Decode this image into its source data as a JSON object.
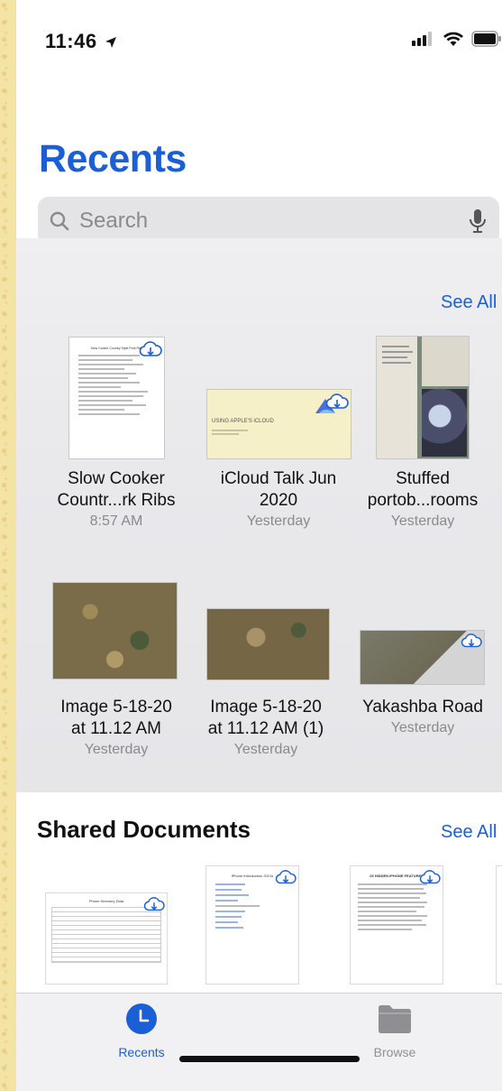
{
  "status_bar": {
    "time": "11:46",
    "location_icon": "location-arrow-icon",
    "signal": "signal-bars-icon",
    "wifi": "wifi-icon",
    "battery": "battery-icon"
  },
  "header": {
    "title": "Recents"
  },
  "search": {
    "placeholder": "Search",
    "icon": "magnifying-glass-icon",
    "mic_icon": "microphone-icon"
  },
  "recents": {
    "see_all": "See All",
    "items": [
      {
        "name_line1": "Slow Cooker",
        "name_line2": "Countr...rk Ribs",
        "date": "8:57 AM",
        "doc_title": "Slow Cooker Country Style Pork Ribs"
      },
      {
        "name_line1": "iCloud Talk Jun",
        "name_line2": "2020",
        "date": "Yesterday",
        "doc_title": "USING APPLE'S iCLOUD"
      },
      {
        "name_line1": "Stuffed",
        "name_line2": "portob...rooms",
        "date": "Yesterday"
      },
      {
        "name_line1": "Image 5-18-20",
        "name_line2": "at 11.12 AM",
        "date": "Yesterday"
      },
      {
        "name_line1": "Image 5-18-20",
        "name_line2": "at 11.12 AM (1)",
        "date": "Yesterday"
      },
      {
        "name_line1": "Yakashba Road",
        "name_line2": "",
        "date": "Yesterday"
      }
    ]
  },
  "shared": {
    "title": "Shared Documents",
    "see_all": "See All",
    "docs": [
      {
        "doc_title": "Phone Directory Data"
      },
      {
        "doc_title": "iPhone Introduction 2021s"
      },
      {
        "doc_title": "25 HIDDEN IPHONE FEATURES"
      }
    ]
  },
  "tabbar": {
    "tabs": [
      {
        "label": "Recents",
        "icon": "clock-icon",
        "active": true
      },
      {
        "label": "Browse",
        "icon": "folder-icon",
        "active": false
      }
    ]
  },
  "colors": {
    "accent": "#1a5fd6",
    "secondary_text": "#8a8a8e"
  }
}
